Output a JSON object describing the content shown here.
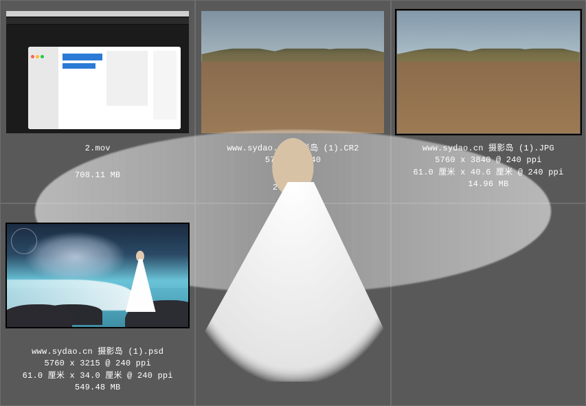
{
  "items": [
    {
      "filename": "2.mov",
      "dimensions": "",
      "physical": "",
      "filesize": "708.11 MB"
    },
    {
      "filename": "www.sydao.cn 摄影岛 (1).CR2",
      "dimensions": "5760 x 3840",
      "physical": "",
      "filesize": "27.85 MB"
    },
    {
      "filename": "www.sydao.cn 摄影岛 (1).JPG",
      "dimensions": "5760 x 3840 @ 240 ppi",
      "physical": "61.0 厘米 x 40.6 厘米 @ 240 ppi",
      "filesize": "14.96 MB"
    },
    {
      "filename": "www.sydao.cn 摄影岛 (1).psd",
      "dimensions": "5760 x 3215 @ 240 ppi",
      "physical": "61.0 厘米 x 34.0 厘米 @ 240 ppi",
      "filesize": "549.48 MB"
    }
  ]
}
